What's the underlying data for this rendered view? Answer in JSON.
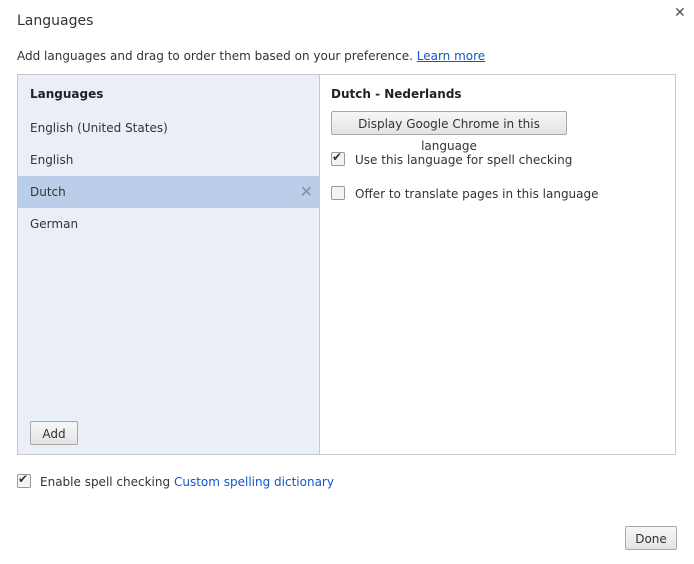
{
  "dialog": {
    "title": "Languages",
    "close_icon": "close-icon",
    "description": "Add languages and drag to order them based on your preference.",
    "learn_more": "Learn more"
  },
  "languages_panel": {
    "header": "Languages",
    "items": [
      {
        "label": "English (United States)",
        "selected": false
      },
      {
        "label": "English",
        "selected": false
      },
      {
        "label": "Dutch",
        "selected": true
      },
      {
        "label": "German",
        "selected": false
      }
    ],
    "remove_icon": "close-icon",
    "add_label": "Add"
  },
  "details": {
    "title": "Dutch - Nederlands",
    "display_button": "Display Google Chrome in this language",
    "spell_check": {
      "label": "Use this language for spell checking",
      "checked": true
    },
    "translate": {
      "label": "Offer to translate pages in this language",
      "checked": false
    }
  },
  "footer": {
    "enable_spell": {
      "label": "Enable spell checking",
      "checked": true
    },
    "custom_dictionary": "Custom spelling dictionary",
    "done_label": "Done"
  }
}
